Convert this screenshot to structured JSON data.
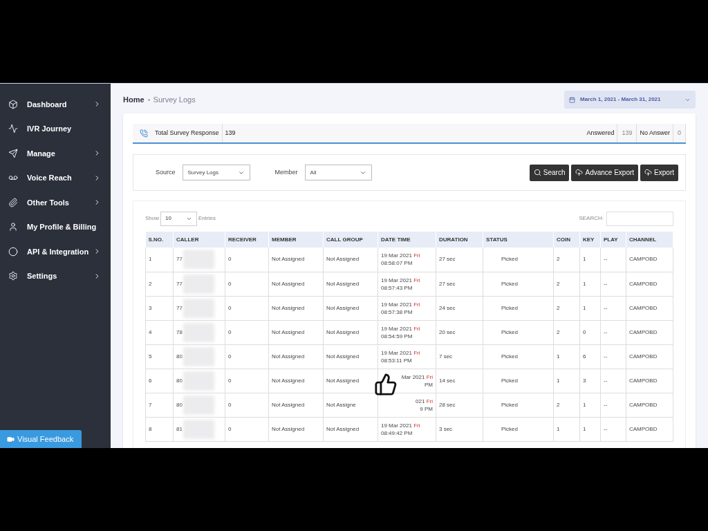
{
  "sidebar": {
    "items": [
      {
        "label": "Dashboard",
        "has_submenu": true
      },
      {
        "label": "IVR Journey",
        "has_submenu": false
      },
      {
        "label": "Manage",
        "has_submenu": true
      },
      {
        "label": "Voice Reach",
        "has_submenu": true
      },
      {
        "label": "Other Tools",
        "has_submenu": true
      },
      {
        "label": "My Profile & Billing",
        "has_submenu": false
      },
      {
        "label": "API & Integration",
        "has_submenu": true
      },
      {
        "label": "Settings",
        "has_submenu": true
      }
    ],
    "feedback_button": "Visual Feedback"
  },
  "breadcrumb": [
    "Home",
    "Survey Logs"
  ],
  "date_range": "March 1, 2021 - March 31, 2021",
  "summary": {
    "label": "Total Survey Response",
    "total": "139",
    "stats": [
      {
        "label": "Answered",
        "value": "139"
      },
      {
        "label": "No Answer",
        "value": "0"
      }
    ]
  },
  "filters": {
    "source": {
      "label": "Source",
      "value": "Survey Logs"
    },
    "member": {
      "label": "Member",
      "value": "All"
    },
    "buttons": [
      "Search",
      "Advance Export",
      "Export"
    ]
  },
  "table": {
    "show_label": "Show",
    "page_size": "10",
    "entries_label": "Entries",
    "search_label": "SEARCH:",
    "columns": [
      "S.NO.",
      "CALLER",
      "RECEIVER",
      "MEMBER",
      "CALL GROUP",
      "DATE TIME",
      "DURATION",
      "STATUS",
      "COIN",
      "KEY",
      "PLAY",
      "CHANNEL"
    ],
    "rows": [
      {
        "sno": "1",
        "caller": "77",
        "receiver": "0",
        "member": "Not Assigned",
        "call_group": "Not Assigned",
        "date": "19 Mar 2021",
        "weekday": "Fri",
        "time": "08:58:07 PM",
        "duration": "27 sec",
        "status": "Picked",
        "coin": "2",
        "key": "1",
        "play": "--",
        "channel": "CAMPOBD"
      },
      {
        "sno": "2",
        "caller": "77",
        "receiver": "0",
        "member": "Not Assigned",
        "call_group": "Not Assigned",
        "date": "19 Mar 2021",
        "weekday": "Fri",
        "time": "08:57:43 PM",
        "duration": "27 sec",
        "status": "Picked",
        "coin": "2",
        "key": "1",
        "play": "--",
        "channel": "CAMPOBD"
      },
      {
        "sno": "3",
        "caller": "77",
        "receiver": "0",
        "member": "Not Assigned",
        "call_group": "Not Assigned",
        "date": "19 Mar 2021",
        "weekday": "Fri",
        "time": "08:57:38 PM",
        "duration": "24 sec",
        "status": "Picked",
        "coin": "2",
        "key": "1",
        "play": "--",
        "channel": "CAMPOBD"
      },
      {
        "sno": "4",
        "caller": "78",
        "receiver": "0",
        "member": "Not Assigned",
        "call_group": "Not Assigned",
        "date": "19 Mar 2021",
        "weekday": "Fri",
        "time": "08:54:59 PM",
        "duration": "20 sec",
        "status": "Picked",
        "coin": "2",
        "key": "0",
        "play": "--",
        "channel": "CAMPOBD"
      },
      {
        "sno": "5",
        "caller": "80",
        "receiver": "0",
        "member": "Not Assigned",
        "call_group": "Not Assigned",
        "date": "19 Mar 2021",
        "weekday": "Fri",
        "time": "08:53:11 PM",
        "duration": "7 sec",
        "status": "Picked",
        "coin": "1",
        "key": "6",
        "play": "--",
        "channel": "CAMPOBD"
      },
      {
        "sno": "6",
        "caller": "80",
        "receiver": "0",
        "member": "Not Assigned",
        "call_group": "Not Assigned",
        "date": "Mar 2021",
        "weekday": "Fri",
        "time": "PM",
        "kind": "partial",
        "duration": "14 sec",
        "status": "Picked",
        "coin": "1",
        "key": "3",
        "play": "--",
        "channel": "CAMPOBD"
      },
      {
        "sno": "7",
        "caller": "80",
        "receiver": "0",
        "member": "Not Assigned",
        "call_group": "Not Assigne",
        "date": "021",
        "weekday": "Fri",
        "time": "9 PM",
        "kind": "partial",
        "duration": "28 sec",
        "status": "Picked",
        "coin": "2",
        "key": "1",
        "play": "--",
        "channel": "CAMPOBD"
      },
      {
        "sno": "8",
        "caller": "81",
        "receiver": "0",
        "member": "Not Assigned",
        "call_group": "Not Assigned",
        "date": "19 Mar 2021",
        "weekday": "Fri",
        "time": "08:49:42 PM",
        "duration": "3 sec",
        "status": "Picked",
        "coin": "1",
        "key": "1",
        "play": "--",
        "channel": "CAMPOBD"
      }
    ]
  }
}
